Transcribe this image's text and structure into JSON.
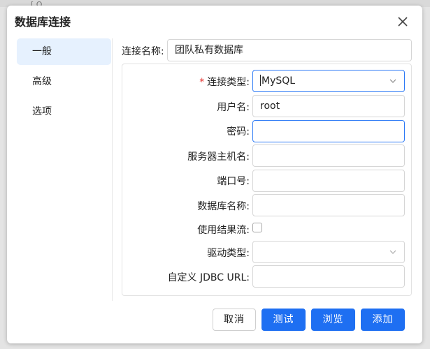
{
  "background": {
    "glyph": "[ Q"
  },
  "dialog": {
    "title": "数据库连接",
    "close_icon": "close-icon"
  },
  "sidebar": {
    "items": [
      {
        "label": "一般",
        "active": true
      },
      {
        "label": "高级",
        "active": false
      },
      {
        "label": "选项",
        "active": false
      }
    ]
  },
  "form": {
    "connection_name": {
      "label": "连接名称:",
      "value": "团队私有数据库"
    },
    "connection_type": {
      "label": "连接类型:",
      "required_mark": "*",
      "value": "MySQL"
    },
    "username": {
      "label": "用户名:",
      "value": "root"
    },
    "password": {
      "label": "密码:",
      "value": ""
    },
    "server_host": {
      "label": "服务器主机名:",
      "value": ""
    },
    "port": {
      "label": "端口号:",
      "value": ""
    },
    "database_name": {
      "label": "数据库名称:",
      "value": ""
    },
    "use_result_stream": {
      "label": "使用结果流:",
      "checked": false
    },
    "driver_type": {
      "label": "驱动类型:",
      "value": ""
    },
    "custom_jdbc_url": {
      "label": "自定义 JDBC URL:",
      "value": ""
    }
  },
  "buttons": {
    "cancel": "取消",
    "test": "测试",
    "browse": "浏览",
    "add": "添加"
  },
  "colors": {
    "accent": "#1e6ff2",
    "active_bg": "#e6f1fe",
    "required": "#e53935"
  }
}
